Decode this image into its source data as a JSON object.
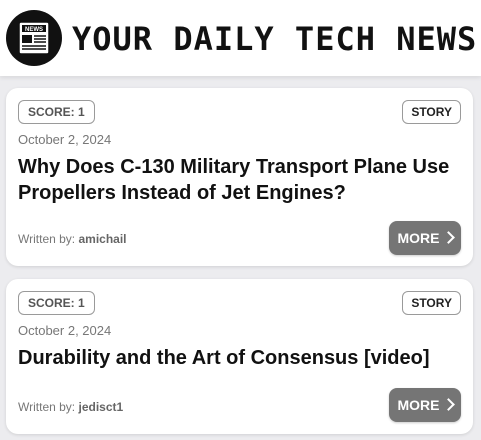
{
  "header": {
    "logo_icon": "newspaper-icon",
    "logo_text": "NEWS",
    "title": "YOUR DAILY TECH NEWS"
  },
  "feed": {
    "items": [
      {
        "score": "SCORE: 1",
        "type": "STORY",
        "date": "October 2, 2024",
        "headline": "Why Does C-130 Military Transport Plane Use Propellers Instead of Jet Engines?",
        "author_label": "Written by:",
        "author": "amichail",
        "more_label": "MORE"
      },
      {
        "score": "SCORE: 1",
        "type": "STORY",
        "date": "October 2, 2024",
        "headline": "Durability and the Art of Consensus [video]",
        "author_label": "Written by:",
        "author": "jedisct1",
        "more_label": "MORE"
      }
    ]
  },
  "colors": {
    "button": "#757575",
    "background": "#ececef",
    "card": "#ffffff"
  }
}
